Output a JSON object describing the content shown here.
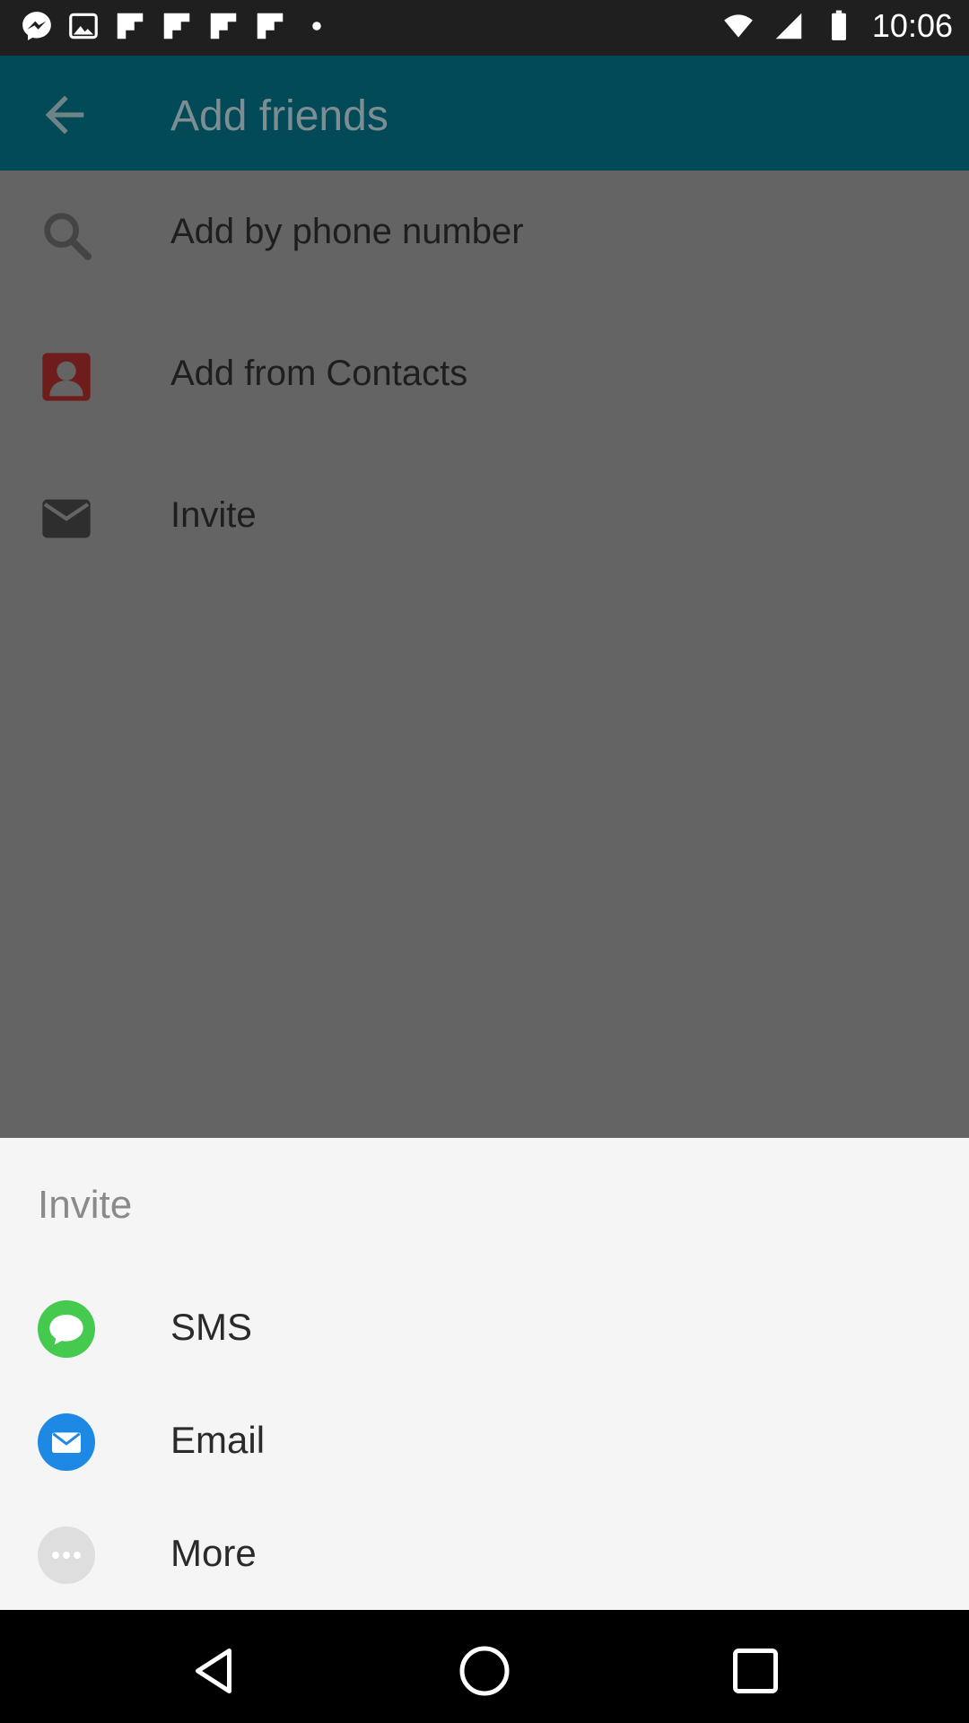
{
  "status_bar": {
    "time": "10:06",
    "left_icons": [
      "messenger-icon",
      "gallery-icon",
      "flipboard-icon",
      "flipboard-icon",
      "flipboard-icon",
      "flipboard-icon",
      "more-dots-icon"
    ],
    "right_icons": [
      "wifi-icon",
      "signal-icon",
      "battery-icon"
    ]
  },
  "app_bar": {
    "title": "Add friends",
    "back_icon": "back-arrow-icon",
    "background": "#024a57"
  },
  "main_list": {
    "items": [
      {
        "label": "Add by phone number",
        "icon": "search-icon"
      },
      {
        "label": "Add from Contacts",
        "icon": "contacts-icon"
      },
      {
        "label": "Invite",
        "icon": "mail-icon"
      }
    ]
  },
  "sheet": {
    "title": "Invite",
    "items": [
      {
        "label": "SMS",
        "icon": "sms-icon",
        "color": "#45c94e"
      },
      {
        "label": "Email",
        "icon": "email-icon",
        "color": "#1e88e5"
      },
      {
        "label": "More",
        "icon": "more-icon",
        "color": "#dedede"
      }
    ]
  },
  "nav_bar": {
    "buttons": [
      "back-triangle-icon",
      "home-circle-icon",
      "recents-square-icon"
    ]
  }
}
